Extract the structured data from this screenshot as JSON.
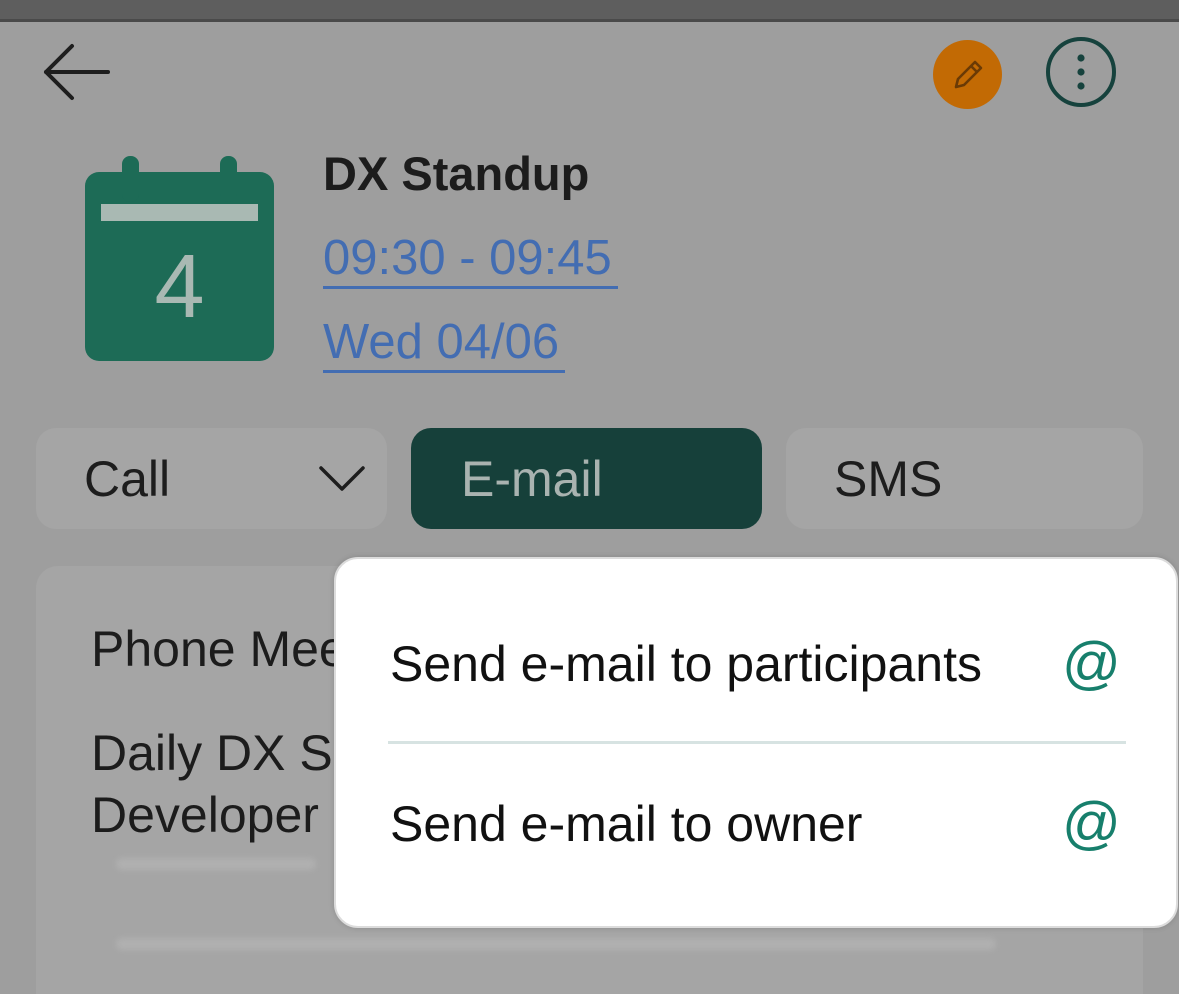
{
  "colors": {
    "edit_button": "#c26a04",
    "primary_dark": "#16403a",
    "calendar_green": "#1d6b56",
    "link_blue": "#436db2",
    "at_icon": "#177f6c"
  },
  "header": {
    "back_icon": "arrow-left-icon",
    "edit_icon": "pencil-icon",
    "more_icon": "vertical-dots-icon"
  },
  "event": {
    "calendar_day": "4",
    "title": "DX Standup",
    "time": "09:30 - 09:45",
    "date": "Wed 04/06"
  },
  "actions": {
    "call_label": "Call",
    "email_label": "E-mail",
    "sms_label": "SMS"
  },
  "description": {
    "line1": "Phone Mee",
    "line2": "Daily DX S",
    "line3": "Developer"
  },
  "email_menu": {
    "items": [
      {
        "label": "Send e-mail to participants",
        "icon": "@"
      },
      {
        "label": "Send e-mail to owner",
        "icon": "@"
      }
    ]
  }
}
